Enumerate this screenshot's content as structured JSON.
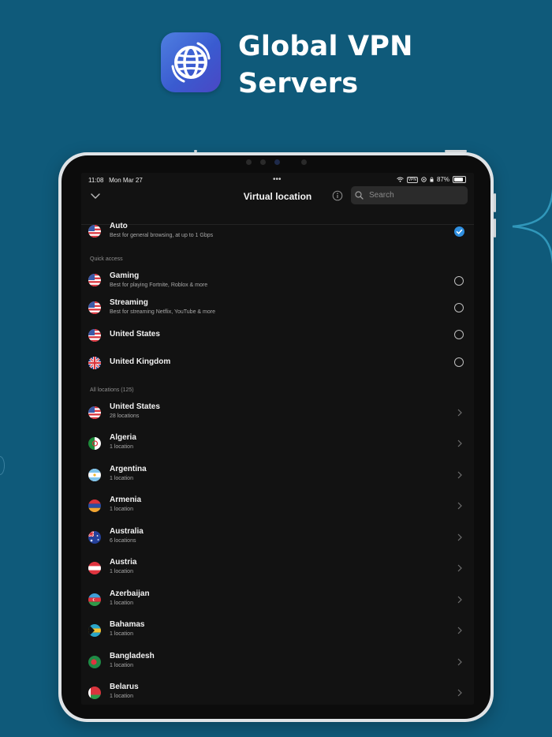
{
  "promo": {
    "title_line1": "Global VPN",
    "title_line2": "Servers"
  },
  "status_bar": {
    "time": "11:08",
    "date": "Mon Mar 27",
    "vpn_label": "VPN",
    "battery": "87%"
  },
  "nav": {
    "title": "Virtual location",
    "search_placeholder": "Search"
  },
  "auto": {
    "title": "Auto",
    "subtitle": "Best for general browsing, at up to 1 Gbps",
    "selected": true
  },
  "quick_access": {
    "label": "Quick access",
    "items": [
      {
        "title": "Gaming",
        "subtitle": "Best for playing Fortnite, Roblox & more"
      },
      {
        "title": "Streaming",
        "subtitle": "Best for streaming Netflix, YouTube & more"
      },
      {
        "title": "United States",
        "subtitle": ""
      },
      {
        "title": "United Kingdom",
        "subtitle": ""
      }
    ]
  },
  "all_locations": {
    "label": "All locations (125)",
    "items": [
      {
        "title": "United States",
        "subtitle": "28 locations"
      },
      {
        "title": "Algeria",
        "subtitle": "1 location"
      },
      {
        "title": "Argentina",
        "subtitle": "1 location"
      },
      {
        "title": "Armenia",
        "subtitle": "1 location"
      },
      {
        "title": "Australia",
        "subtitle": "6 locations"
      },
      {
        "title": "Austria",
        "subtitle": "1 location"
      },
      {
        "title": "Azerbaijan",
        "subtitle": "1 location"
      },
      {
        "title": "Bahamas",
        "subtitle": "1 location"
      },
      {
        "title": "Bangladesh",
        "subtitle": "1 location"
      },
      {
        "title": "Belarus",
        "subtitle": "1 location"
      }
    ]
  },
  "colors": {
    "background": "#0f5a7a",
    "screen": "#121212",
    "accent": "#2f8fe0"
  },
  "icons": [
    "globe-icon",
    "chevron-down-icon",
    "info-icon",
    "search-icon",
    "checkmark-icon",
    "chevron-right-icon",
    "wifi-icon",
    "battery-icon"
  ]
}
